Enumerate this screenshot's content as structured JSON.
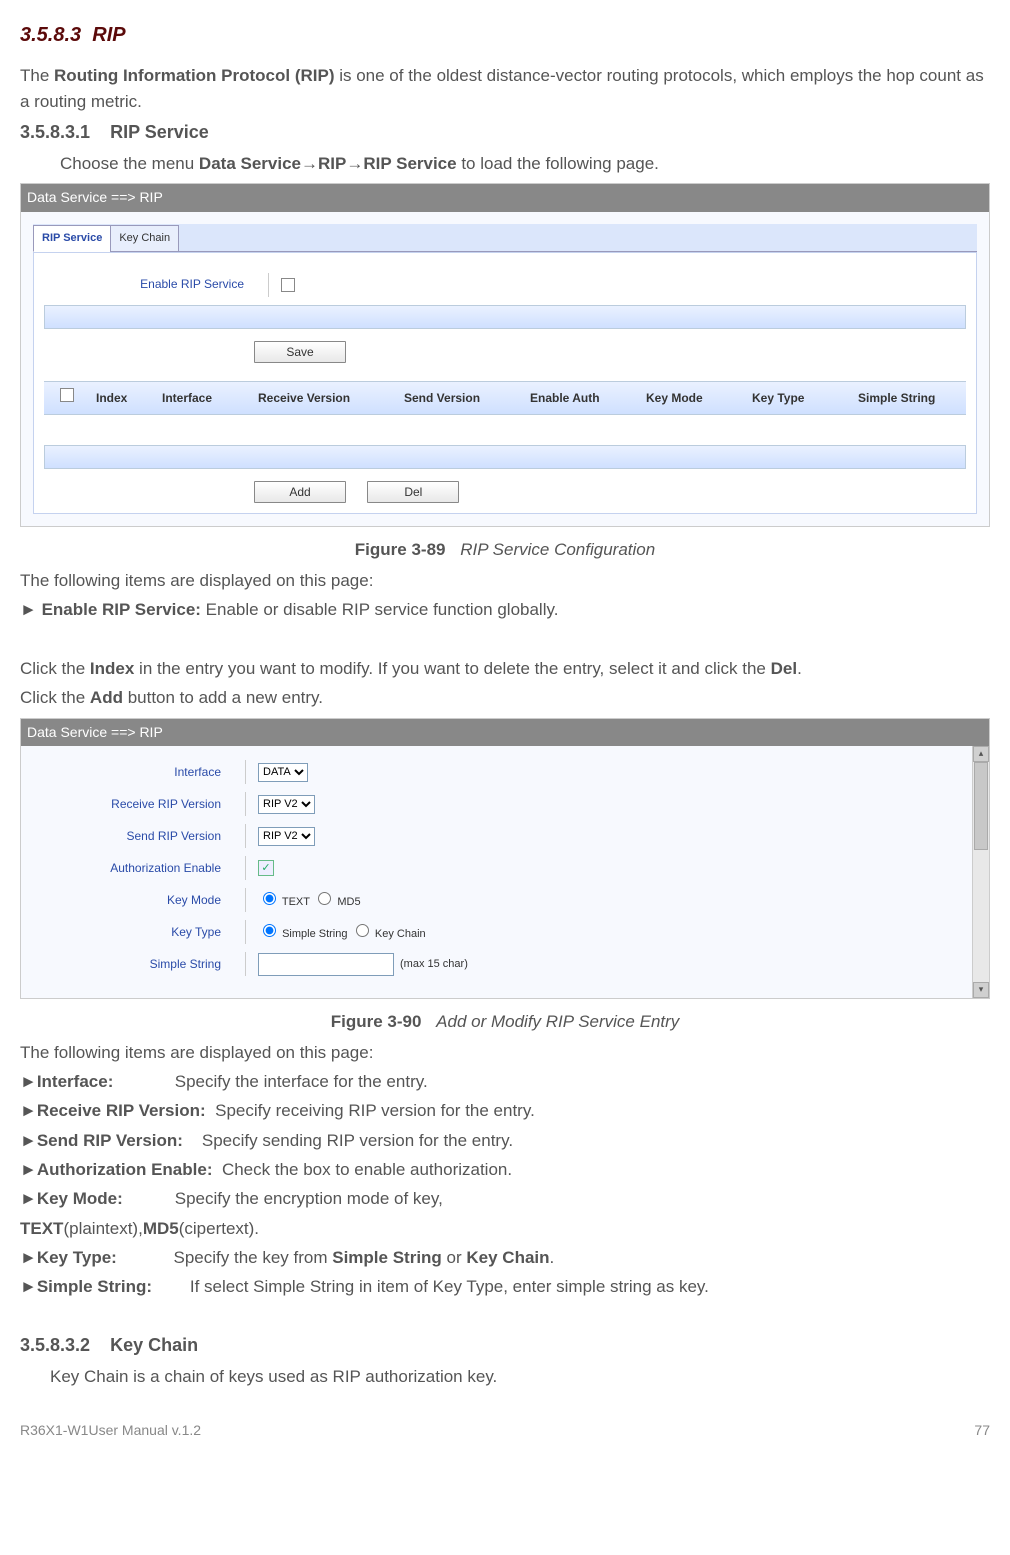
{
  "section": {
    "number": "3.5.8.3",
    "title": "RIP",
    "intro_prefix": "The ",
    "intro_bold": "Routing Information Protocol (RIP)",
    "intro_suffix": " is one of the oldest distance-vector routing protocols, which employs the hop count as a routing metric."
  },
  "sub1": {
    "number": "3.5.8.3.1",
    "title": "RIP Service",
    "nav_prefix": "Choose the menu ",
    "nav_b1": "Data Service",
    "nav_arrow1": "→",
    "nav_b2": "RIP",
    "nav_arrow2": "→",
    "nav_b3": "RIP Service",
    "nav_suffix": " to load the following page."
  },
  "fig1": {
    "breadcrumb": "Data Service ==> RIP",
    "tabs": [
      "RIP Service",
      "Key Chain"
    ],
    "enable_label": "Enable RIP Service",
    "save": "Save",
    "add": "Add",
    "del": "Del",
    "headers": [
      "Index",
      "Interface",
      "Receive Version",
      "Send Version",
      "Enable Auth",
      "Key Mode",
      "Key Type",
      "Simple String"
    ],
    "caption_num": "Figure 3-89",
    "caption_title": "RIP Service Configuration"
  },
  "para_after_fig1": {
    "l1": "The following items are displayed on this page:",
    "l2_pre": "► ",
    "l2_b": "Enable RIP Service:",
    "l2_after": " Enable or disable RIP service function globally.",
    "l3_pre": "Click the ",
    "l3_b1": "Index",
    "l3_mid": " in the entry you want to modify. If you want to delete the entry, select it and click the ",
    "l3_b2": "Del",
    "l3_end": ".",
    "l4_pre": "Click the ",
    "l4_b": "Add",
    "l4_end": " button to add a new entry."
  },
  "fig2": {
    "breadcrumb": "Data Service ==> RIP",
    "labels": {
      "interface": "Interface",
      "recv": "Receive RIP Version",
      "send": "Send RIP Version",
      "auth": "Authorization Enable",
      "keymode": "Key Mode",
      "keytype": "Key Type",
      "simple": "Simple String"
    },
    "values": {
      "interface_opt": "DATA",
      "recv_opt": "RIP V2",
      "send_opt": "RIP V2",
      "keymode_opts": [
        "TEXT",
        "MD5"
      ],
      "keytype_opts": [
        "Simple String",
        "Key Chain"
      ],
      "simple_hint": "(max 15 char)"
    },
    "caption_num": "Figure 3-90",
    "caption_title": "Add or Modify RIP Service Entry"
  },
  "items2": {
    "intro": "The following items are displayed on this page:",
    "rows": [
      {
        "label": "Interface:",
        "desc": "Specify the interface for the entry."
      },
      {
        "label": "Receive RIP Version:",
        "desc": "Specify receiving RIP version for the entry."
      },
      {
        "label": "Send RIP Version:",
        "desc": "Specify sending RIP version for the entry."
      },
      {
        "label": "Authorization Enable:",
        "desc": "Check the box to enable authorization."
      }
    ],
    "keymode_label": "Key Mode:",
    "keymode_pre": "Specify the encryption mode of key, ",
    "km_b1": "TEXT",
    "km_p1": "(plaintext),",
    "km_b2": "MD5",
    "km_p2": "(cipertext).",
    "keytype_label": "Key Type:",
    "keytype_pre": "Specify the key from ",
    "kt_b1": "Simple String",
    "kt_or": " or ",
    "kt_b2": "Key Chain",
    "kt_end": ".",
    "simple_label": "Simple String:",
    "simple_desc": "If select Simple String in item of Key Type, enter simple string as key."
  },
  "sub2": {
    "number": "3.5.8.3.2",
    "title": "Key Chain",
    "text": "Key Chain is a chain of keys used as RIP authorization key."
  },
  "footer": {
    "left": "R36X1-W1User Manual v.1.2",
    "right": "77"
  }
}
